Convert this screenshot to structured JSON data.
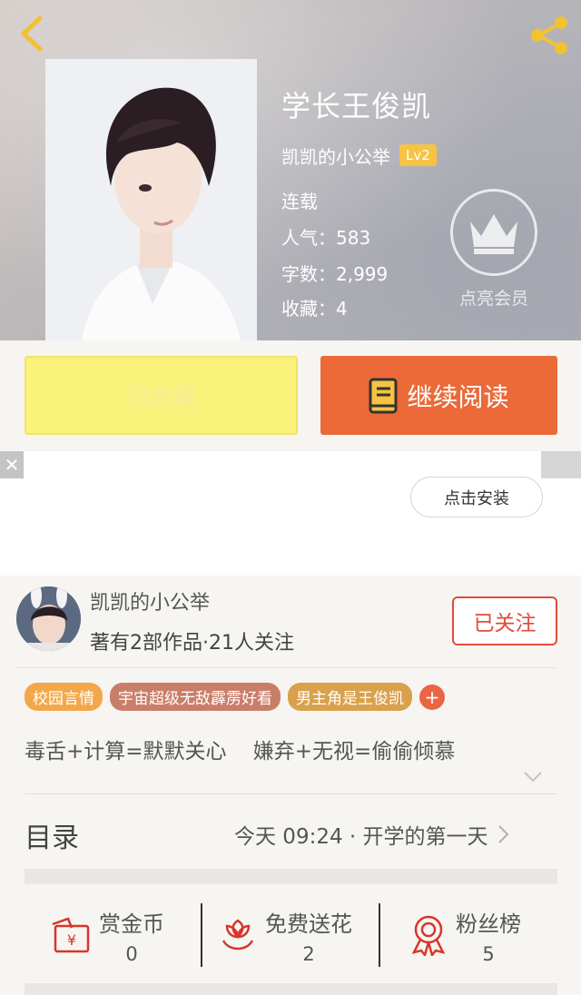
{
  "book": {
    "title": "学长王俊凯",
    "author": "凯凯的小公举",
    "level": "Lv2",
    "status": "连载",
    "popularity": "人气：583",
    "words": "字数：2,999",
    "favorites": "收藏：4"
  },
  "vip": {
    "label": "点亮会员"
  },
  "actions": {
    "collected_label": "已收藏",
    "read_label": "继续阅读"
  },
  "ad": {
    "install_label": "点击安装",
    "close_glyph": "✕"
  },
  "author_card": {
    "name": "凯凯的小公举",
    "stats": "著有2部作品·21人关注",
    "follow_label": "已关注"
  },
  "tags": [
    {
      "label": "校园言情",
      "color": "#f2a84a"
    },
    {
      "label": "宇宙超级无敌霹雳好看",
      "color": "#c97e6a"
    },
    {
      "label": "男主角是王俊凯",
      "color": "#d9a14b"
    }
  ],
  "tag_more": "+",
  "description": "毒舌+计算=默默关心    嫌弃+无视=偷偷倾慕",
  "toc": {
    "label": "目录",
    "latest": "今天 09:24 · 开学的第一天"
  },
  "stats": [
    {
      "label": "赏金币",
      "value": "0",
      "icon": "coin-envelope-icon"
    },
    {
      "label": "免费送花",
      "value": "2",
      "icon": "flower-icon"
    },
    {
      "label": "粉丝榜",
      "value": "5",
      "icon": "ribbon-medal-icon"
    }
  ],
  "colors": {
    "accent": "#eb6a38",
    "collected": "#fbf27c",
    "follow": "#e34a3a",
    "icon_red": "#d9352a"
  }
}
